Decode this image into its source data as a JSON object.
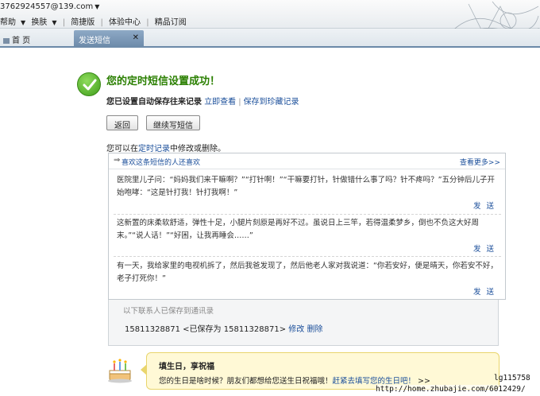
{
  "account": {
    "email": "3762924557@139.com"
  },
  "menu": [
    "帮助",
    "换肤",
    "简捷版",
    "体验中心",
    "精品订阅"
  ],
  "tabs": {
    "home": "首 页",
    "active": "发送短信"
  },
  "success": {
    "title": "您的定时短信设置成功！",
    "saved_prefix": "您已设置自动保存往来记录",
    "view_now": "立即查看",
    "save_collection": "保存到珍藏记录"
  },
  "buttons": {
    "back": "返回",
    "continue": "继续写短信"
  },
  "modify_note": {
    "prefix": "您可以在",
    "link": "定时记录",
    "suffix": "中修改或删除。"
  },
  "recommend": {
    "title": "喜欢这条短信的人还喜欢",
    "more": "查看更多>>",
    "send_label": "发 送",
    "messages": [
      "医院里儿子问：“妈妈我们来干嘛啊？”“打针啊！”“干嘛要打针，针做错什么事了吗？针不疼吗？”五分钟后儿子开始咆哮：“这是针打我！针打我啊！”",
      "这新置的床柔软舒适，弹性十足，小腿片刻原是再好不过。虽说日上三竿，若得温柔梦乡，倒也不负这大好周末。”“说人话！”“好困，让我再睡会……”",
      "有一天，我给家里的电视机拆了，然后我爸发现了，然后他老人家对我说道：“你若安好，便是晴天，你若安不好，老子打死你！”"
    ]
  },
  "contacts": {
    "hint": "以下联系人已保存到通讯录",
    "number": "15811328871",
    "saved_as": " <已保存为 15811328871> ",
    "edit": "修改",
    "delete": "删除"
  },
  "birthday": {
    "title": "填生日，享祝福",
    "question": "您的生日是啥时候？朋友们都想给您送生日祝福哦！",
    "link": "赶紧去填写您的生日吧！",
    "chevrons": " >>"
  },
  "watermark": {
    "user": "lg115758",
    "url": "http://home.zhubajie.com/6012429/"
  }
}
